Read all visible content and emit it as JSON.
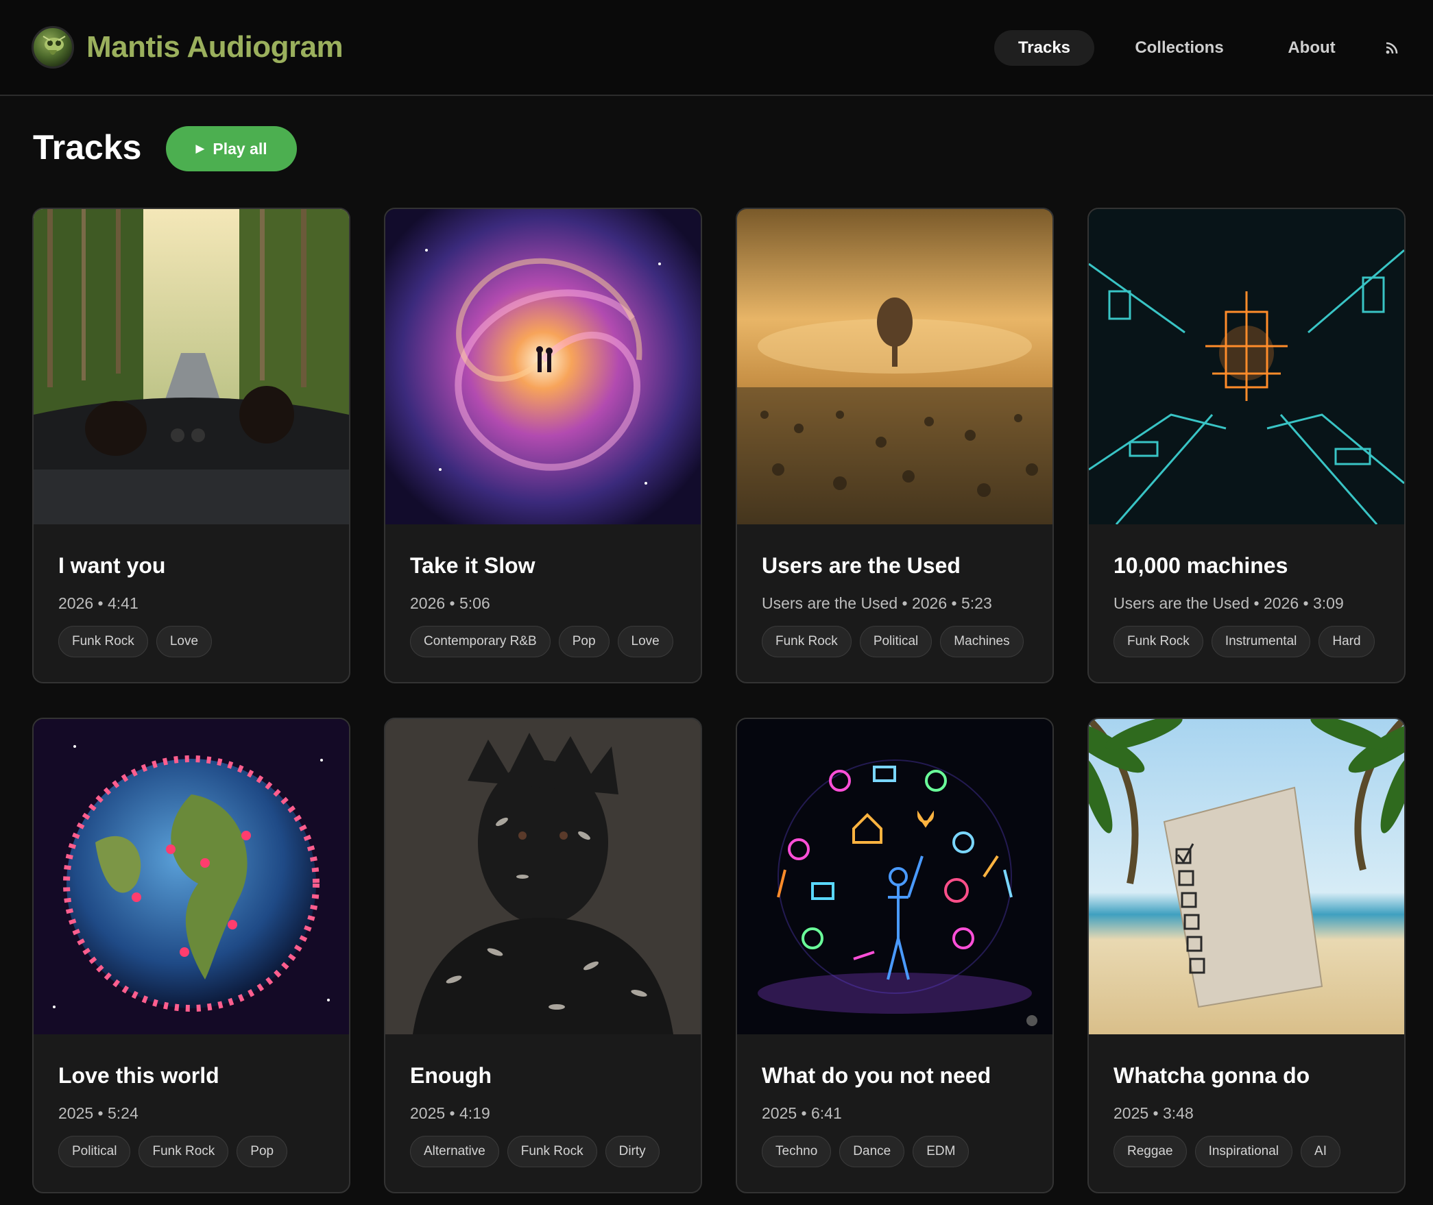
{
  "brand": {
    "name": "Mantis Audiogram",
    "logo_icon": "mantis-logo"
  },
  "nav": {
    "items": [
      {
        "label": "Tracks",
        "active": true
      },
      {
        "label": "Collections",
        "active": false
      },
      {
        "label": "About",
        "active": false
      }
    ],
    "rss_icon": "rss-icon"
  },
  "page": {
    "title": "Tracks",
    "play_all_label": "Play all",
    "play_icon": "play-icon"
  },
  "colors": {
    "brand": "#9bb05d",
    "accent": "#4caf50",
    "background": "#0d0d0d",
    "card": "#1a1a1a"
  },
  "tracks": [
    {
      "title": "I want you",
      "meta": "2026 • 4:41",
      "tags": [
        "Funk Rock",
        "Love"
      ],
      "art": "convertible-forest-road"
    },
    {
      "title": "Take it Slow",
      "meta": "2026 • 5:06",
      "tags": [
        "Contemporary R&B",
        "Pop",
        "Love"
      ],
      "art": "couple-in-galaxy-swirl"
    },
    {
      "title": "Users are the Used",
      "meta": "Users are the Used • 2026 • 5:23",
      "tags": [
        "Funk Rock",
        "Political",
        "Machines"
      ],
      "art": "robot-head-over-crowd"
    },
    {
      "title": "10,000 machines",
      "meta": "Users are the Used • 2026 • 3:09",
      "tags": [
        "Funk Rock",
        "Instrumental",
        "Hard"
      ],
      "art": "glowing-circuit-city"
    },
    {
      "title": "Love this world",
      "meta": "2025 • 5:24",
      "tags": [
        "Political",
        "Funk Rock",
        "Pop"
      ],
      "art": "earth-covered-in-hearts"
    },
    {
      "title": "Enough",
      "meta": "2025 • 4:19",
      "tags": [
        "Alternative",
        "Funk Rock",
        "Dirty"
      ],
      "art": "man-covered-in-feathers"
    },
    {
      "title": "What do you not need",
      "meta": "2025 • 6:41",
      "tags": [
        "Techno",
        "Dance",
        "EDM"
      ],
      "art": "neon-icon-sphere"
    },
    {
      "title": "Whatcha gonna do",
      "meta": "2025 • 3:48",
      "tags": [
        "Reggae",
        "Inspirational",
        "AI"
      ],
      "art": "checklist-on-beach"
    }
  ]
}
